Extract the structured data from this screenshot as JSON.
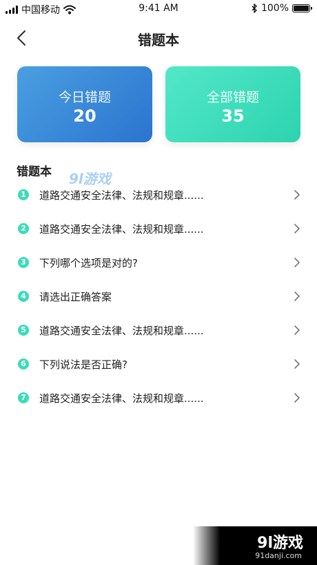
{
  "status_bar": {
    "carrier": "中国移动",
    "time": "9:41 AM",
    "battery": "100%"
  },
  "nav": {
    "title": "错题本"
  },
  "cards": {
    "today": {
      "label": "今日错题",
      "value": "20"
    },
    "all": {
      "label": "全部错题",
      "value": "35"
    }
  },
  "section": {
    "title": "错题本"
  },
  "items": [
    {
      "number": "1",
      "text": "道路交通安全法律、法规和规章......"
    },
    {
      "number": "2",
      "text": "道路交通安全法律、法规和规章......"
    },
    {
      "number": "3",
      "text": "下列哪个选项是对的?"
    },
    {
      "number": "4",
      "text": "请选出正确答案"
    },
    {
      "number": "5",
      "text": "道路交通安全法律、法规和规章......"
    },
    {
      "number": "6",
      "text": "下列说法是否正确?"
    },
    {
      "number": "7",
      "text": "道路交通安全法律、法规和规章......"
    }
  ],
  "watermark": {
    "top": "9l游戏",
    "brand": "9l游戏",
    "domain": "91danji.com"
  },
  "colors": {
    "accent_teal": "#3ddcb8",
    "card_blue": "#2b74d0",
    "card_teal": "#2dd3b0"
  }
}
